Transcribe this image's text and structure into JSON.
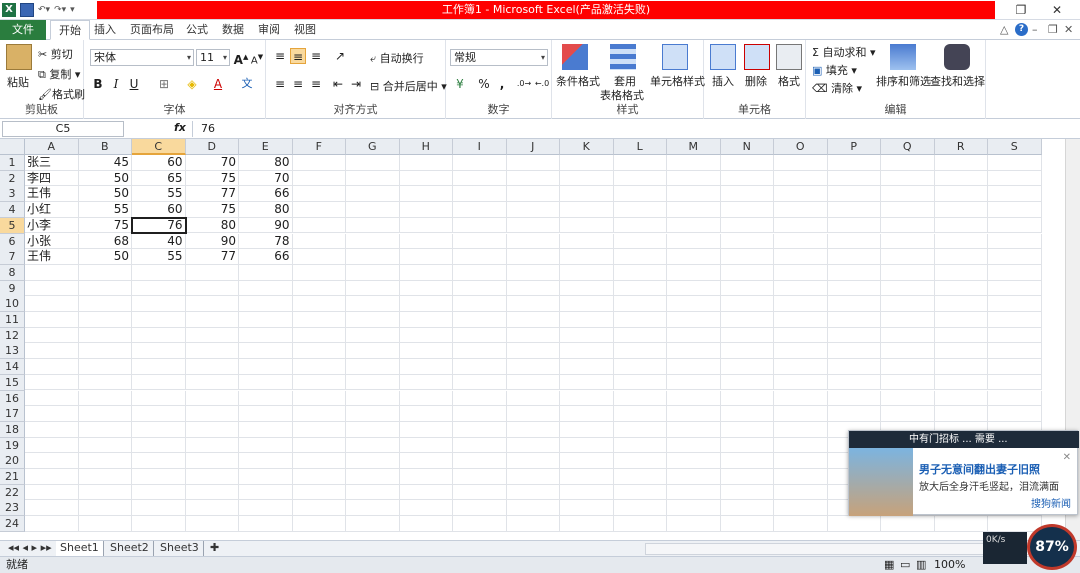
{
  "window": {
    "title": "工作簿1 - Microsoft Excel(产品激活失败)",
    "title_bar_color": "#ff0000"
  },
  "ribbon_tabs": [
    "文件",
    "开始",
    "插入",
    "页面布局",
    "公式",
    "数据",
    "审阅",
    "视图"
  ],
  "active_tab": "开始",
  "clipboard": {
    "paste": "粘贴",
    "cut": "剪切",
    "copy": "复制",
    "format_painter": "格式刷",
    "label": "剪贴板"
  },
  "font_group": {
    "font_name": "宋体",
    "font_size": "11",
    "label": "字体"
  },
  "align_group": {
    "wrap": "自动换行",
    "merge": "合并后居中",
    "label": "对齐方式"
  },
  "number_group": {
    "format": "常规",
    "percent": "%",
    "comma": ",",
    "label": "数字"
  },
  "styles_group": {
    "cond": "条件格式",
    "table": "套用",
    "table2": "表格格式",
    "cell": "单元格样式",
    "label": "样式"
  },
  "cells_group": {
    "insert": "插入",
    "delete": "删除",
    "format": "格式",
    "label": "单元格"
  },
  "edit_group": {
    "autosum": "自动求和",
    "fill": "填充",
    "clear": "清除",
    "sort": "排序和筛选",
    "find": "查找和选择",
    "label": "编辑"
  },
  "formula_bar": {
    "name_box": "C5",
    "fx": "fx",
    "value": "76"
  },
  "columns": [
    "A",
    "B",
    "C",
    "D",
    "E",
    "F",
    "G",
    "H",
    "I",
    "J",
    "K",
    "L",
    "M",
    "N",
    "O",
    "P",
    "Q",
    "R",
    "S"
  ],
  "rows": [
    "1",
    "2",
    "3",
    "4",
    "5",
    "6",
    "7",
    "8",
    "9",
    "10",
    "11",
    "12",
    "13",
    "14",
    "15",
    "16",
    "17",
    "18",
    "19",
    "20",
    "21",
    "22",
    "23",
    "24"
  ],
  "table": [
    [
      "张三",
      "45",
      "60",
      "70",
      "80"
    ],
    [
      "李四",
      "50",
      "65",
      "75",
      "70"
    ],
    [
      "王伟",
      "50",
      "55",
      "77",
      "66"
    ],
    [
      "小红",
      "55",
      "60",
      "75",
      "80"
    ],
    [
      "小李",
      "75",
      "76",
      "80",
      "90"
    ],
    [
      "小张",
      "68",
      "40",
      "90",
      "78"
    ],
    [
      "王伟",
      "50",
      "55",
      "77",
      "66"
    ]
  ],
  "sheets": [
    "Sheet1",
    "Sheet2",
    "Sheet3"
  ],
  "status": {
    "ready": "就绪",
    "zoom": "100%"
  },
  "popup": {
    "header": "中有门招标 ... 需要 ...",
    "title": "男子无意间翻出妻子旧照",
    "subtitle": "放大后全身汗毛竖起，泪流满面",
    "link": "搜狗新闻"
  },
  "speed_widget": {
    "percent": "87%",
    "rate": "0K/s"
  }
}
